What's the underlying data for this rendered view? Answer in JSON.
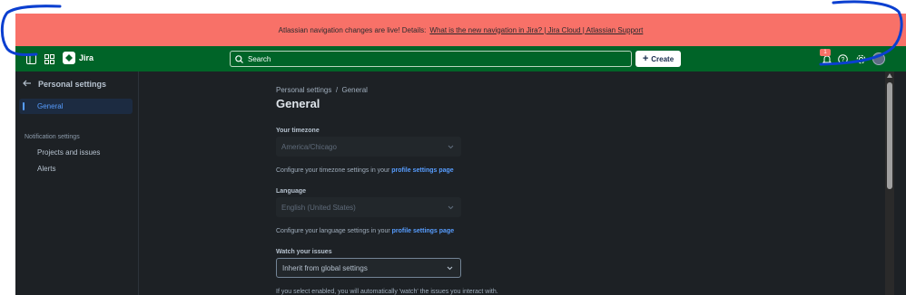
{
  "banner": {
    "text": "Atlassian navigation changes are live! Details:",
    "link": "What is the new navigation in Jira? | Jira Cloud | Atlassian Support"
  },
  "topnav": {
    "product": "Jira",
    "search_placeholder": "Search",
    "create_label": "Create",
    "notification_count": "1"
  },
  "sidebar": {
    "back_label": "Personal settings",
    "items": [
      {
        "label": "General",
        "active": true
      },
      {
        "label": "Projects and issues",
        "active": false
      },
      {
        "label": "Alerts",
        "active": false
      }
    ],
    "section_heading": "Notification settings"
  },
  "main": {
    "breadcrumb": "Personal settings  /  General",
    "title": "General",
    "timezone": {
      "label": "Your timezone",
      "value": "America/Chicago",
      "help_text": "Configure your timezone settings in your",
      "help_link": "profile settings page"
    },
    "language": {
      "label": "Language",
      "value": "English (United States)",
      "help_text": "Configure your language settings in your",
      "help_link": "profile settings page"
    },
    "watch": {
      "label": "Watch your issues",
      "value": "Inherit from global settings",
      "help_text": "If you select enabled, you will automatically 'watch' the issues you interact with."
    }
  },
  "colors": {
    "banner_bg": "#f87168",
    "topnav_bg": "#006428",
    "app_bg": "#1d2125",
    "accent": "#579dff",
    "annotation": "#0b3fd0"
  }
}
